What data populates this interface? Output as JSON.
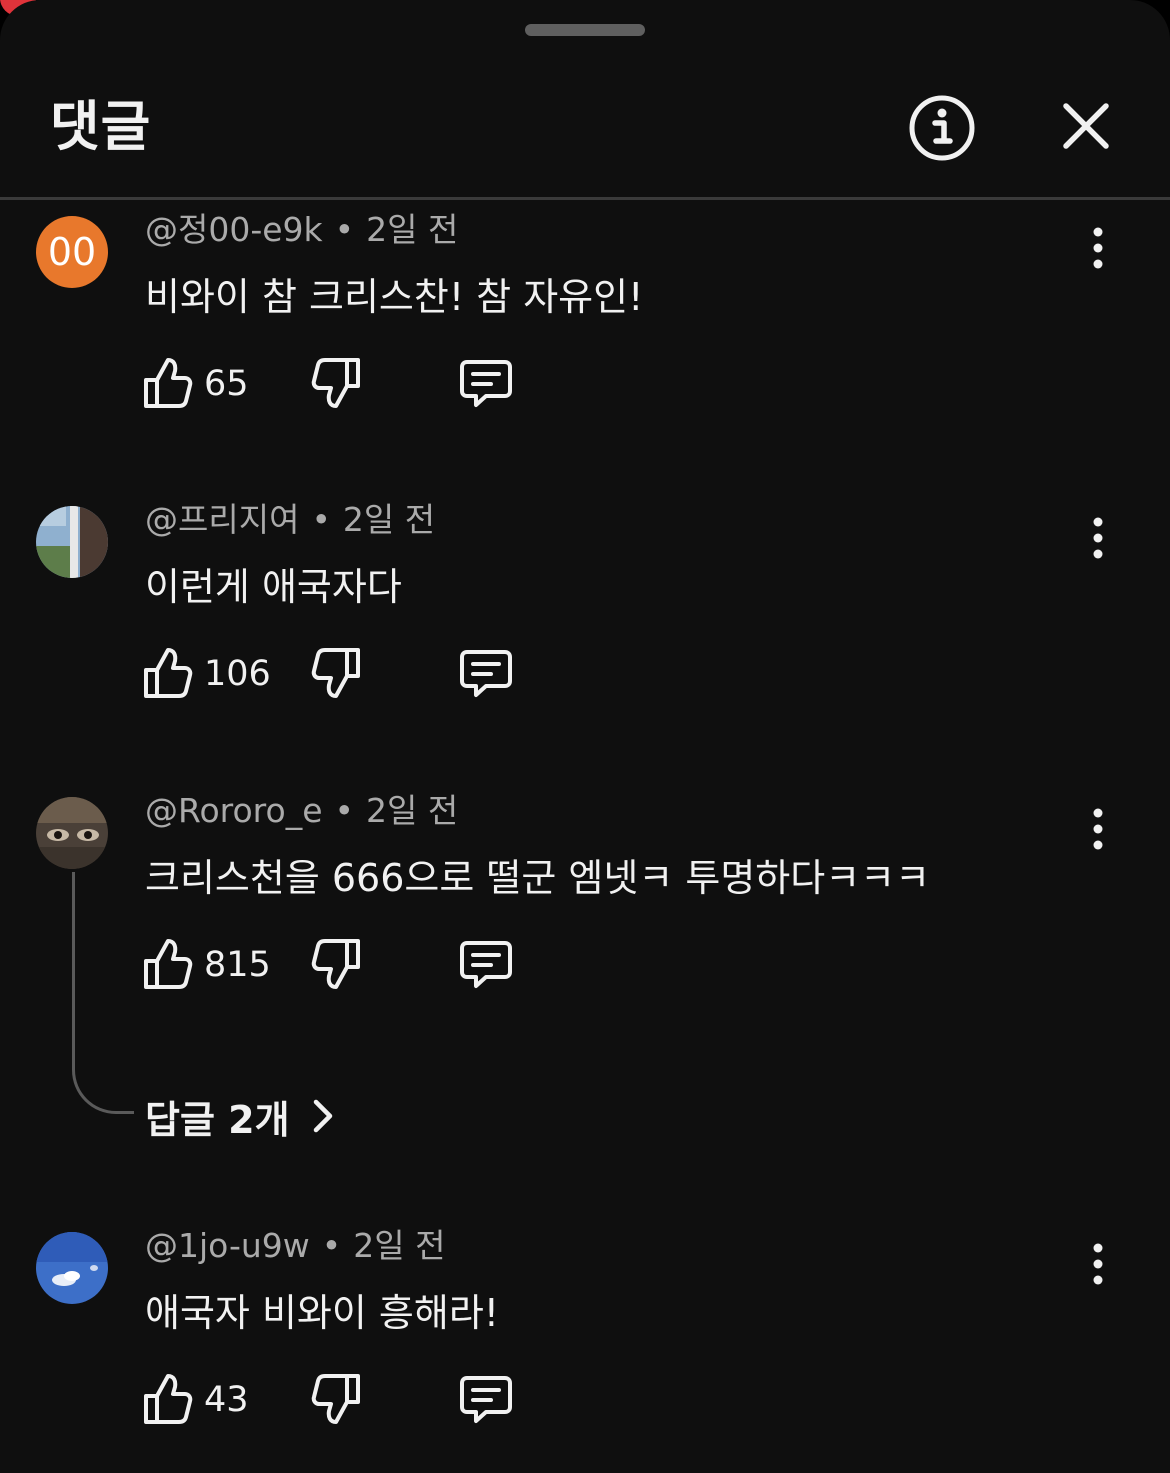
{
  "header": {
    "title": "댓글",
    "info_icon": "info-icon",
    "close_icon": "close-icon"
  },
  "comments": [
    {
      "author": "@정00-e9k",
      "time": "2일 전",
      "text": "비와이 참 크리스찬! 참 자유인!",
      "likes": "65",
      "avatar": {
        "type": "initials",
        "initials": "00",
        "color": "#e8782c"
      }
    },
    {
      "author": "@프리지여",
      "time": "2일 전",
      "text": "이런게 애국자다",
      "likes": "106",
      "avatar": {
        "type": "photo",
        "icon": "window-photo-avatar"
      }
    },
    {
      "author": "@Rororo_e",
      "time": "2일 전",
      "text": "크리스천을 666으로 떨군 엠넷ㅋ 투명하다ㅋㅋㅋ",
      "likes": "815",
      "avatar": {
        "type": "photo",
        "icon": "eyes-photo-avatar"
      }
    },
    {
      "author": "@1jo-u9w",
      "time": "2일 전",
      "text": "애국자 비와이 흥해라!",
      "likes": "43",
      "avatar": {
        "type": "photo",
        "icon": "sky-photo-avatar"
      }
    }
  ],
  "replies": {
    "label": "답글 2개"
  },
  "meta_separator": "•"
}
